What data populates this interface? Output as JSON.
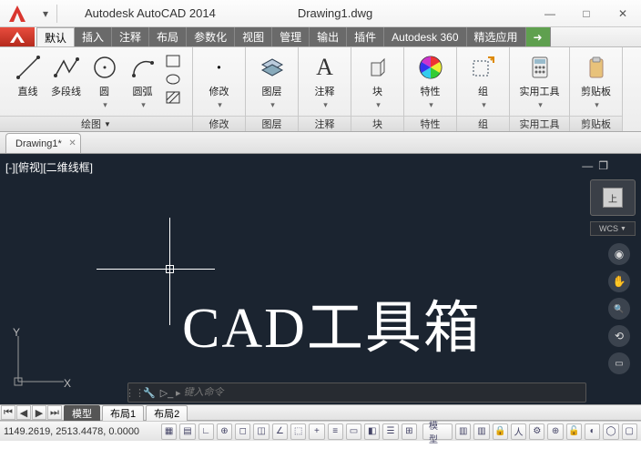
{
  "titlebar": {
    "app_title": "Autodesk AutoCAD 2014",
    "doc_title": "Drawing1.dwg"
  },
  "menu": {
    "items": [
      "默认",
      "插入",
      "注释",
      "布局",
      "参数化",
      "视图",
      "管理",
      "输出",
      "插件",
      "Autodesk 360",
      "精选应用",
      "➜"
    ]
  },
  "ribbon": {
    "panels": [
      {
        "title": "绘图",
        "big": [
          {
            "k": "line",
            "l": "直线"
          },
          {
            "k": "polyline",
            "l": "多段线"
          },
          {
            "k": "circle",
            "l": "圆"
          },
          {
            "k": "arc",
            "l": "圆弧"
          }
        ]
      },
      {
        "title": "修改",
        "big": [
          {
            "k": "modify",
            "l": "修改"
          }
        ]
      },
      {
        "title": "图层",
        "big": [
          {
            "k": "layer",
            "l": "图层"
          }
        ]
      },
      {
        "title": "注释",
        "big": [
          {
            "k": "annot",
            "l": "注释"
          }
        ]
      },
      {
        "title": "块",
        "big": [
          {
            "k": "block",
            "l": "块"
          }
        ]
      },
      {
        "title": "特性",
        "big": [
          {
            "k": "props",
            "l": "特性"
          }
        ]
      },
      {
        "title": "组",
        "big": [
          {
            "k": "group",
            "l": "组"
          }
        ]
      },
      {
        "title": "实用工具",
        "big": [
          {
            "k": "util",
            "l": "实用工具"
          }
        ]
      },
      {
        "title": "剪贴板",
        "big": [
          {
            "k": "clip",
            "l": "剪贴板"
          }
        ]
      }
    ]
  },
  "doctab": {
    "name": "Drawing1*"
  },
  "viewport": {
    "info": "[-][俯视][二维线框]",
    "wcs": "WCS",
    "cube": "上"
  },
  "watermark": "CAD工具箱",
  "cmd": {
    "placeholder": "键入命令"
  },
  "layout": {
    "tabs": [
      "模型",
      "布局1",
      "布局2"
    ]
  },
  "status": {
    "coords": "1149.2619, 2513.4478, 0.0000",
    "model": "模型"
  }
}
